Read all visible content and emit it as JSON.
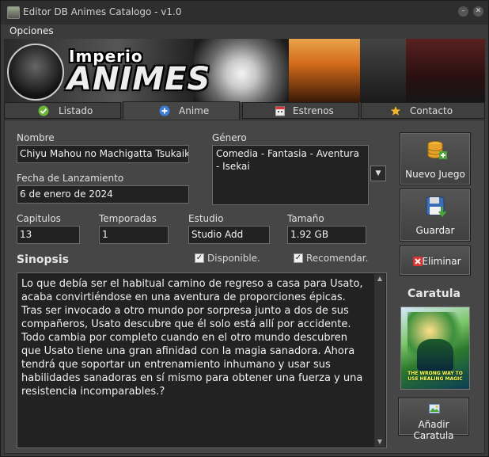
{
  "window": {
    "title": "Editor DB Animes Catalogo  - v1.0"
  },
  "menu": {
    "options": "Opciones"
  },
  "banner": {
    "logo_top": "Imperio",
    "logo_main": "ANIMES"
  },
  "tabs": [
    {
      "label": "Listado",
      "icon": "check-icon"
    },
    {
      "label": "Anime",
      "icon": "plus-circle-icon"
    },
    {
      "label": "Estrenos",
      "icon": "calendar-icon"
    },
    {
      "label": "Contacto",
      "icon": "star-icon"
    }
  ],
  "active_tab": "Anime",
  "form": {
    "nombre_label": "Nombre",
    "nombre_value": "Chiyu Mahou no Machigatta Tsukaikata",
    "fecha_label": "Fecha de Lanzamiento",
    "fecha_value": "6 de enero de 2024",
    "genero_label": "Género",
    "genero_value": "Comedia - Fantasia - Aventura - Isekai",
    "capitulos_label": "Capitulos",
    "capitulos_value": "13",
    "temporadas_label": "Temporadas",
    "temporadas_value": "1",
    "estudio_label": "Estudio",
    "estudio_value": "Studio Add",
    "tamano_label": "Tamaño",
    "tamano_value": "1.92 GB",
    "sinopsis_label": "Sinopsis",
    "disponible_label": "Disponible.",
    "disponible_checked": true,
    "recomendar_label": "Recomendar.",
    "recomendar_checked": true,
    "sinopsis_text": "Lo que debía ser el habitual camino de regreso a casa para Usato, acaba convirtiéndose en una aventura de proporciones épicas. Tras ser invocado a otro mundo por sorpresa junto a dos de sus compañeros, Usato descubre que él solo está allí por accidente. Todo cambia por completo cuando en el otro mundo descubren que Usato tiene una gran afinidad con la magia sanadora. Ahora tendrá que soportar un entrenamiento inhumano y usar sus habilidades sanadoras en sí mismo para obtener una fuerza y una resistencia incomparables.?"
  },
  "buttons": {
    "nuevo": "Nuevo Juego",
    "guardar": "Guardar",
    "eliminar": "Eliminar",
    "anadir_caratula": "Añadir Caratula"
  },
  "caratula": {
    "title": "Caratula",
    "cover_text": "THE WRONG WAY TO USE HEALING MAGIC"
  },
  "colors": {
    "background": "#464646",
    "input_bg": "#222222",
    "window": "#3a3a3a"
  }
}
